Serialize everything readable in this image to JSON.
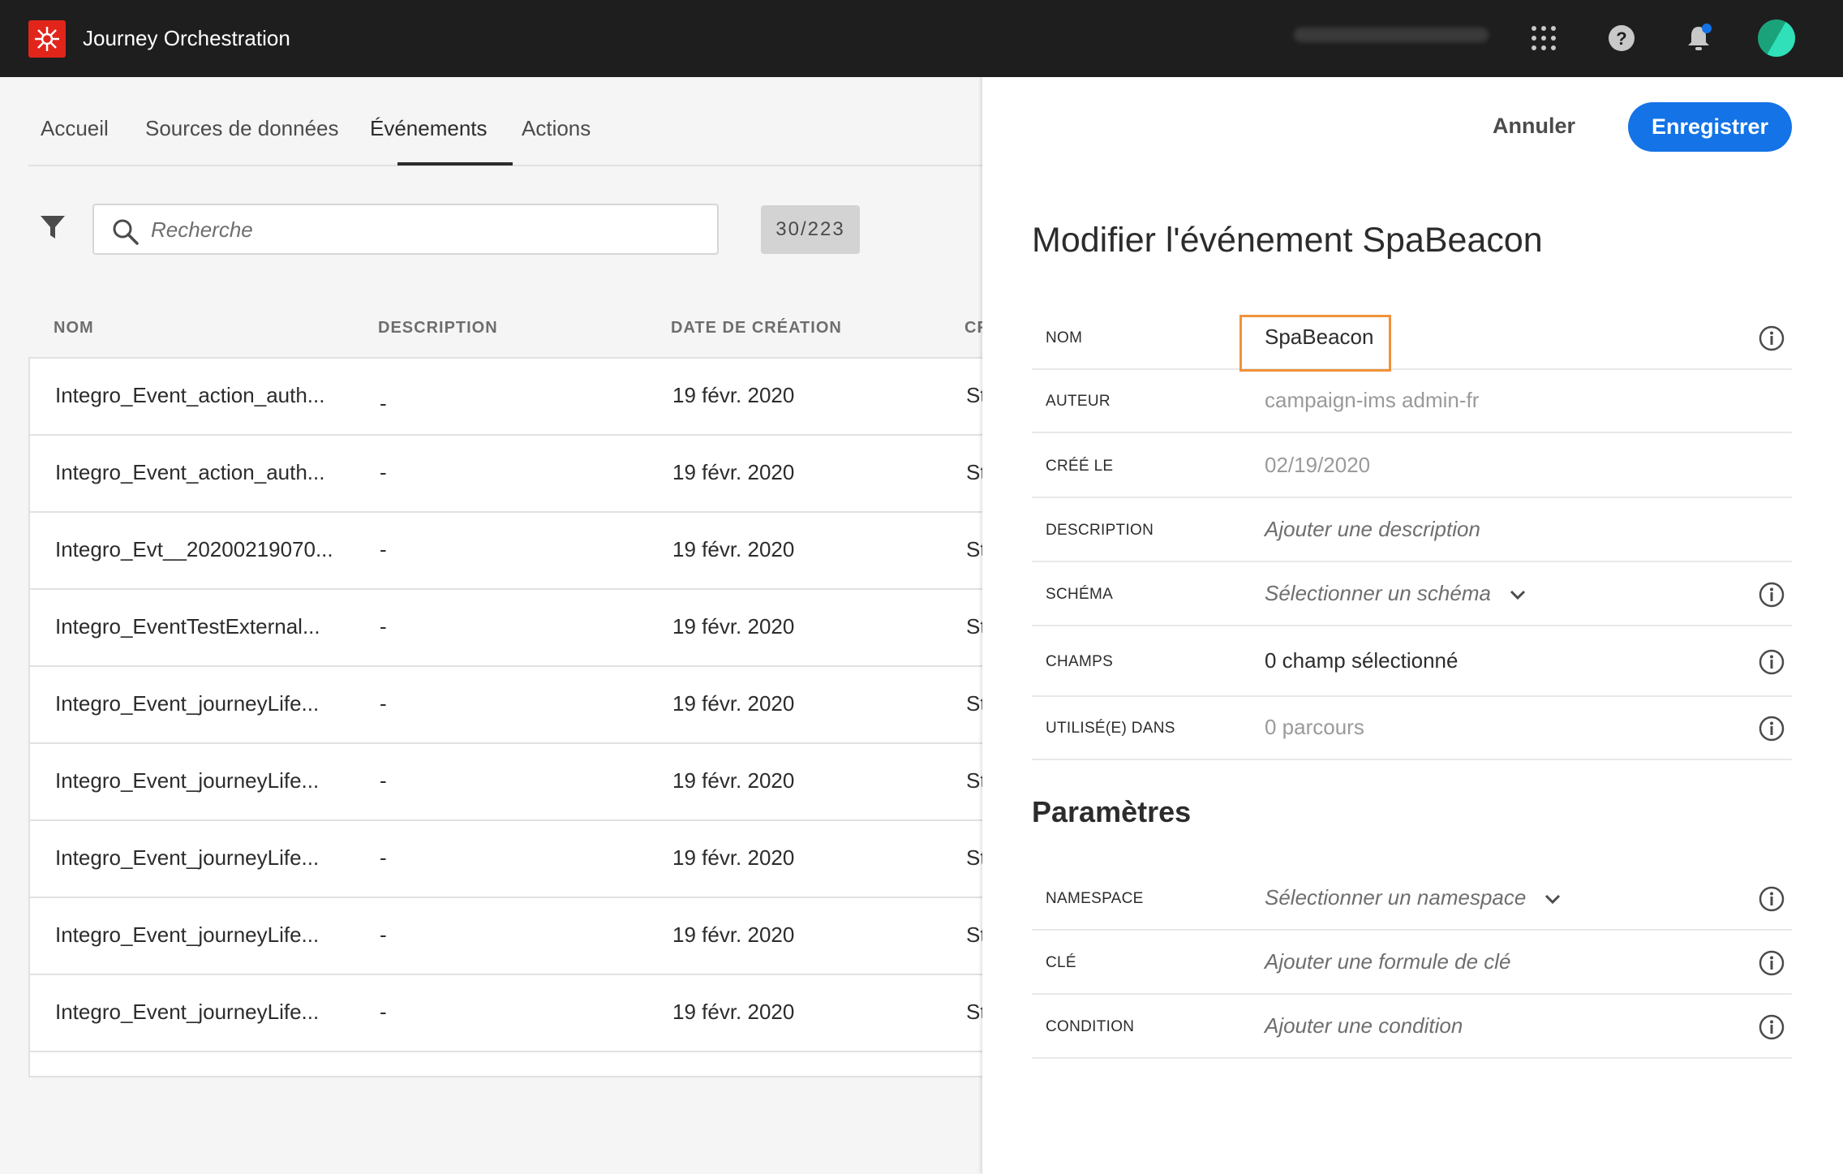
{
  "app": {
    "title": "Journey Orchestration"
  },
  "topbar": {
    "icons": [
      "apps-grid-icon",
      "help-icon",
      "notifications-icon"
    ],
    "colors": {
      "background": "#1e1e1e",
      "logo": "#e1251b",
      "notification_dot": "#1473e6"
    }
  },
  "nav": {
    "tabs": [
      {
        "label": "Accueil"
      },
      {
        "label": "Sources de données"
      },
      {
        "label": "Événements"
      },
      {
        "label": "Actions"
      }
    ],
    "active_tab": "Événements"
  },
  "search": {
    "placeholder": "Recherche",
    "value": ""
  },
  "count": "30/223",
  "table": {
    "columns": [
      "NOM",
      "DESCRIPTION",
      "DATE DE CRÉATION",
      "CR"
    ],
    "rows": [
      {
        "name": "Integro_Event_action_auth...",
        "description": "-",
        "date": "19 févr. 2020",
        "creator": "St"
      },
      {
        "name": "Integro_Event_action_auth...",
        "description": "-",
        "date": "19 févr. 2020",
        "creator": "St"
      },
      {
        "name": "Integro_Evt__20200219070...",
        "description": "-",
        "date": "19 févr. 2020",
        "creator": "St"
      },
      {
        "name": "Integro_EventTestExternal...",
        "description": "-",
        "date": "19 févr. 2020",
        "creator": "St"
      },
      {
        "name": "Integro_Event_journeyLife...",
        "description": "-",
        "date": "19 févr. 2020",
        "creator": "St"
      },
      {
        "name": "Integro_Event_journeyLife...",
        "description": "-",
        "date": "19 févr. 2020",
        "creator": "St"
      },
      {
        "name": "Integro_Event_journeyLife...",
        "description": "-",
        "date": "19 févr. 2020",
        "creator": "St"
      },
      {
        "name": "Integro_Event_journeyLife...",
        "description": "-",
        "date": "19 févr. 2020",
        "creator": "St"
      },
      {
        "name": "Integro_Event_journeyLife...",
        "description": "-",
        "date": "19 févr. 2020",
        "creator": "St"
      }
    ]
  },
  "drawer": {
    "cancel_label": "Annuler",
    "save_label": "Enregistrer",
    "title": "Modifier l'événement SpaBeacon",
    "fields": {
      "name": {
        "label": "NOM",
        "value": "SpaBeacon"
      },
      "author": {
        "label": "AUTEUR",
        "value": "campaign-ims admin-fr"
      },
      "created": {
        "label": "CRÉÉ LE",
        "value": "02/19/2020"
      },
      "description": {
        "label": "DESCRIPTION",
        "placeholder": "Ajouter une description"
      },
      "schema": {
        "label": "SCHÉMA",
        "placeholder": "Sélectionner un schéma"
      },
      "fields": {
        "label": "CHAMPS",
        "value": "0 champ sélectionné"
      },
      "used_in": {
        "label": "UTILISÉ(E) DANS",
        "value": "0 parcours"
      }
    },
    "params_title": "Paramètres",
    "params": {
      "namespace": {
        "label": "NAMESPACE",
        "placeholder": "Sélectionner un namespace"
      },
      "key": {
        "label": "CLÉ",
        "placeholder": "Ajouter une formule de clé"
      },
      "condition": {
        "label": "CONDITION",
        "placeholder": "Ajouter une condition"
      }
    },
    "colors": {
      "accent": "#1473e6",
      "highlight": "#f0923a"
    }
  }
}
